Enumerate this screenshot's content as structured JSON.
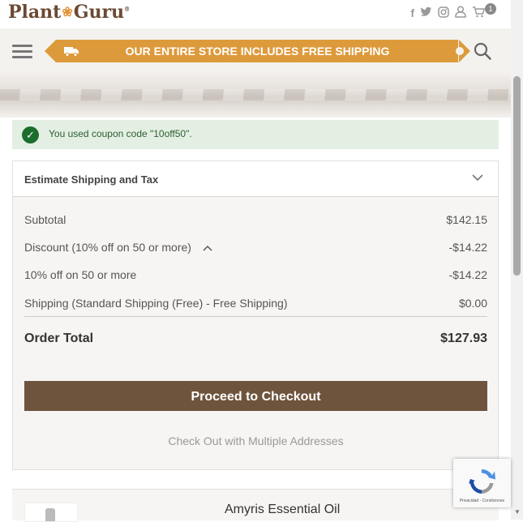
{
  "header": {
    "logo_left": "Plant",
    "logo_right": "Guru",
    "logo_mark": "®",
    "social_icons": [
      "facebook-icon",
      "twitter-icon",
      "instagram-icon",
      "user-icon",
      "cart-icon"
    ],
    "cart_count": "1"
  },
  "navbar": {
    "promo_text": "OUR ENTIRE STORE INCLUDES FREE SHIPPING",
    "colors": {
      "promo": "#dd9a3b",
      "nav_bg": "#f3f2ef"
    }
  },
  "coupon": {
    "message": "You used coupon code \"10off50\"."
  },
  "summary": {
    "estimate_label": "Estimate Shipping and Tax",
    "rows": [
      {
        "label": "Subtotal",
        "value": "$142.15"
      },
      {
        "label": "Discount (10% off on 50 or more)",
        "value": "-$14.22"
      },
      {
        "label": "10% off on 50 or more",
        "value": "-$14.22"
      },
      {
        "label": "Shipping (Standard Shipping (Free) - Free Shipping)",
        "value": "$0.00"
      }
    ],
    "total_label": "Order Total",
    "total_value": "$127.93",
    "checkout_label": "Proceed to Checkout",
    "multi_label": "Check Out with Multiple Addresses",
    "colors": {
      "checkout_button": "#6e543c",
      "coupon_icon": "#1c6e2c"
    }
  },
  "product": {
    "name": "Amyris Essential Oil"
  },
  "recaptcha": {
    "text": "Privacidad - Condiciones"
  }
}
